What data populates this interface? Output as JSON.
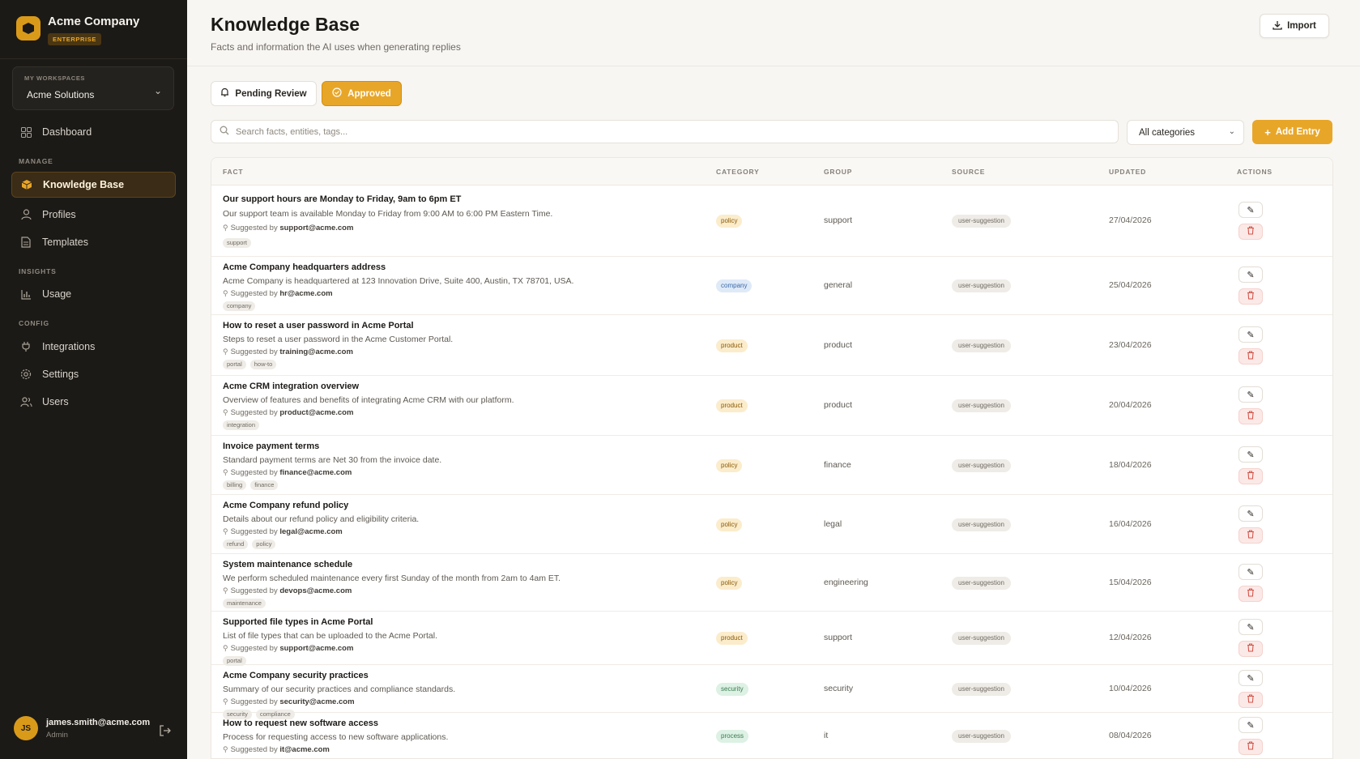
{
  "brand": {
    "name": "Acme Company",
    "badge": "ENTERPRISE"
  },
  "workspace": {
    "label": "MY WORKSPACES",
    "name": "Acme Solutions"
  },
  "nav": {
    "dashboard": "Dashboard",
    "manage_section": "MANAGE",
    "knowledge_base": "Knowledge Base",
    "profiles": "Profiles",
    "templates": "Templates",
    "insights_section": "INSIGHTS",
    "usage": "Usage",
    "config_section": "CONFIG",
    "integrations": "Integrations",
    "settings": "Settings",
    "users": "Users"
  },
  "user": {
    "initials": "JS",
    "email": "james.smith@acme.com",
    "role": "Admin"
  },
  "header": {
    "title": "Knowledge Base",
    "subtitle": "Facts and information the AI uses when generating replies",
    "import_label": "Import"
  },
  "tabs": {
    "pending": "Pending Review",
    "approved": "Approved",
    "active": "approved"
  },
  "search": {
    "placeholder": "Search facts, entities, tags..."
  },
  "category_filter": {
    "selected": "All categories"
  },
  "add_entry_label": "Add Entry",
  "table": {
    "columns": {
      "fact": "FACT",
      "category": "CATEGORY",
      "group": "GROUP",
      "source": "SOURCE",
      "updated": "UPDATED",
      "actions": "ACTIONS"
    },
    "suggested_prefix": "Suggested by",
    "rows": [
      {
        "title": "Our support hours are Monday to Friday, 9am to 6pm ET",
        "desc": "Our support team is available Monday to Friday from 9:00 AM to 6:00 PM Eastern Time.",
        "by": "support@acme.com",
        "tags": [
          "support"
        ],
        "category": "policy",
        "group": "support",
        "source": "user-suggestion",
        "updated": "27/04/2026"
      },
      {
        "title": "Acme Company headquarters address",
        "desc": "Acme Company is headquartered at 123 Innovation Drive, Suite 400, Austin, TX 78701, USA.",
        "by": "hr@acme.com",
        "tags": [
          "company"
        ],
        "category": "company",
        "group": "general",
        "source": "user-suggestion",
        "updated": "25/04/2026"
      },
      {
        "title": "How to reset a user password in Acme Portal",
        "desc": "Steps to reset a user password in the Acme Customer Portal.",
        "by": "training@acme.com",
        "tags": [
          "portal",
          "how-to"
        ],
        "category": "product",
        "group": "product",
        "source": "user-suggestion",
        "updated": "23/04/2026"
      },
      {
        "title": "Acme CRM integration overview",
        "desc": "Overview of features and benefits of integrating Acme CRM with our platform.",
        "by": "product@acme.com",
        "tags": [
          "integration"
        ],
        "category": "product",
        "group": "product",
        "source": "user-suggestion",
        "updated": "20/04/2026"
      },
      {
        "title": "Invoice payment terms",
        "desc": "Standard payment terms are Net 30 from the invoice date.",
        "by": "finance@acme.com",
        "tags": [
          "billing",
          "finance"
        ],
        "category": "policy",
        "group": "finance",
        "source": "user-suggestion",
        "updated": "18/04/2026"
      },
      {
        "title": "Acme Company refund policy",
        "desc": "Details about our refund policy and eligibility criteria.",
        "by": "legal@acme.com",
        "tags": [
          "refund",
          "policy"
        ],
        "category": "policy",
        "group": "legal",
        "source": "user-suggestion",
        "updated": "16/04/2026"
      },
      {
        "title": "System maintenance schedule",
        "desc": "We perform scheduled maintenance every first Sunday of the month from 2am to 4am ET.",
        "by": "devops@acme.com",
        "tags": [
          "maintenance"
        ],
        "category": "policy",
        "group": "engineering",
        "source": "user-suggestion",
        "updated": "15/04/2026"
      },
      {
        "title": "Supported file types in Acme Portal",
        "desc": "List of file types that can be uploaded to the Acme Portal.",
        "by": "support@acme.com",
        "tags": [
          "portal"
        ],
        "category": "product",
        "group": "support",
        "source": "user-suggestion",
        "updated": "12/04/2026"
      },
      {
        "title": "Acme Company security practices",
        "desc": "Summary of our security practices and compliance standards.",
        "by": "security@acme.com",
        "tags": [
          "security",
          "compliance"
        ],
        "category": "security",
        "group": "security",
        "source": "user-suggestion",
        "updated": "10/04/2026"
      },
      {
        "title": "How to request new software access",
        "desc": "Process for requesting access to new software applications.",
        "by": "it@acme.com",
        "tags": [],
        "category": "process",
        "group": "it",
        "source": "user-suggestion",
        "updated": "08/04/2026"
      }
    ]
  }
}
